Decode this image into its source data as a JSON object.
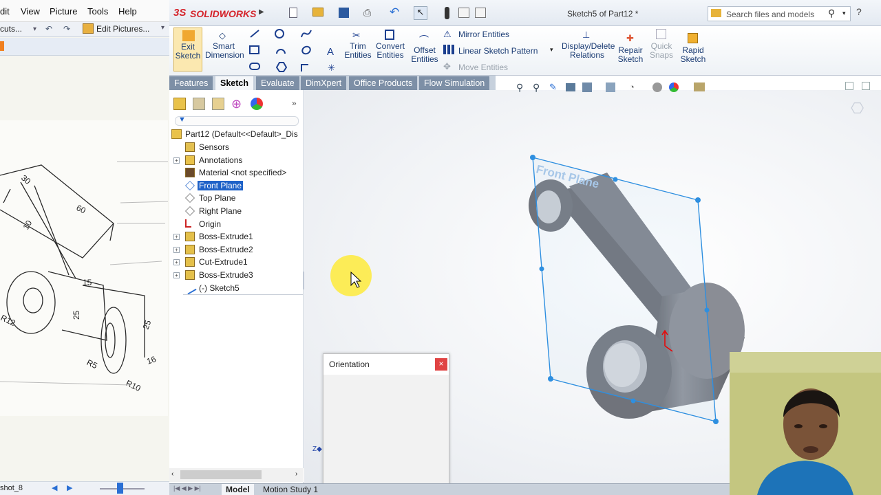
{
  "viewer": {
    "menu": [
      "dit",
      "View",
      "Picture",
      "Tools",
      "Help"
    ],
    "toolbar_text": "cuts...",
    "edit_pictures": "Edit Pictures...",
    "status_file": "shot_8",
    "drawing_dims": [
      "30",
      "60",
      "10",
      "15",
      "25",
      "R12",
      "R5",
      "R10",
      "16",
      "25"
    ]
  },
  "sw": {
    "logo": "SOLIDWORKS",
    "doc_title": "Sketch5 of Part12 *",
    "search_placeholder": "Search files and models",
    "commands": {
      "exit_sketch": [
        "Exit",
        "Sketch"
      ],
      "smart_dimension": [
        "Smart",
        "Dimension"
      ],
      "trim_entities": [
        "Trim",
        "Entities"
      ],
      "convert_entities": [
        "Convert",
        "Entities"
      ],
      "offset_entities": [
        "Offset",
        "Entities"
      ],
      "mirror_entities": "Mirror Entities",
      "linear_sketch_pattern": "Linear Sketch Pattern",
      "move_entities": "Move Entities",
      "display_delete_relations": [
        "Display/Delete",
        "Relations"
      ],
      "repair_sketch": [
        "Repair",
        "Sketch"
      ],
      "quick_snaps": [
        "Quick",
        "Snaps"
      ],
      "rapid_sketch": [
        "Rapid",
        "Sketch"
      ]
    },
    "tabs": [
      "Features",
      "Sketch",
      "Evaluate",
      "DimXpert",
      "Office Products",
      "Flow Simulation"
    ],
    "active_tab": "Sketch",
    "tree": {
      "root": "Part12  (Default<<Default>_Dis",
      "items": [
        {
          "label": "Sensors",
          "icon": "sensor-icon",
          "expandable": false
        },
        {
          "label": "Annotations",
          "icon": "annotations-icon",
          "expandable": true
        },
        {
          "label": "Material <not specified>",
          "icon": "material-icon",
          "expandable": false
        },
        {
          "label": "Front Plane",
          "icon": "plane-icon",
          "expandable": false,
          "selected": true
        },
        {
          "label": "Top Plane",
          "icon": "plane-icon",
          "expandable": false
        },
        {
          "label": "Right Plane",
          "icon": "plane-icon",
          "expandable": false
        },
        {
          "label": "Origin",
          "icon": "origin-icon",
          "expandable": false
        },
        {
          "label": "Boss-Extrude1",
          "icon": "feature-icon",
          "expandable": true
        },
        {
          "label": "Boss-Extrude2",
          "icon": "feature-icon",
          "expandable": true
        },
        {
          "label": "Cut-Extrude1",
          "icon": "feature-icon",
          "expandable": true
        },
        {
          "label": "Boss-Extrude3",
          "icon": "feature-icon",
          "expandable": true
        },
        {
          "label": "(-) Sketch5",
          "icon": "sketch-icon",
          "expandable": false
        }
      ]
    },
    "plane_label": "Front Plane",
    "orientation_title": "Orientation",
    "bottom_tabs": [
      "Model",
      "Motion Study 1"
    ]
  },
  "colors": {
    "accent": "#1e62c8",
    "tab_bg": "#7d8fa6",
    "logo_red": "#d5232a"
  }
}
